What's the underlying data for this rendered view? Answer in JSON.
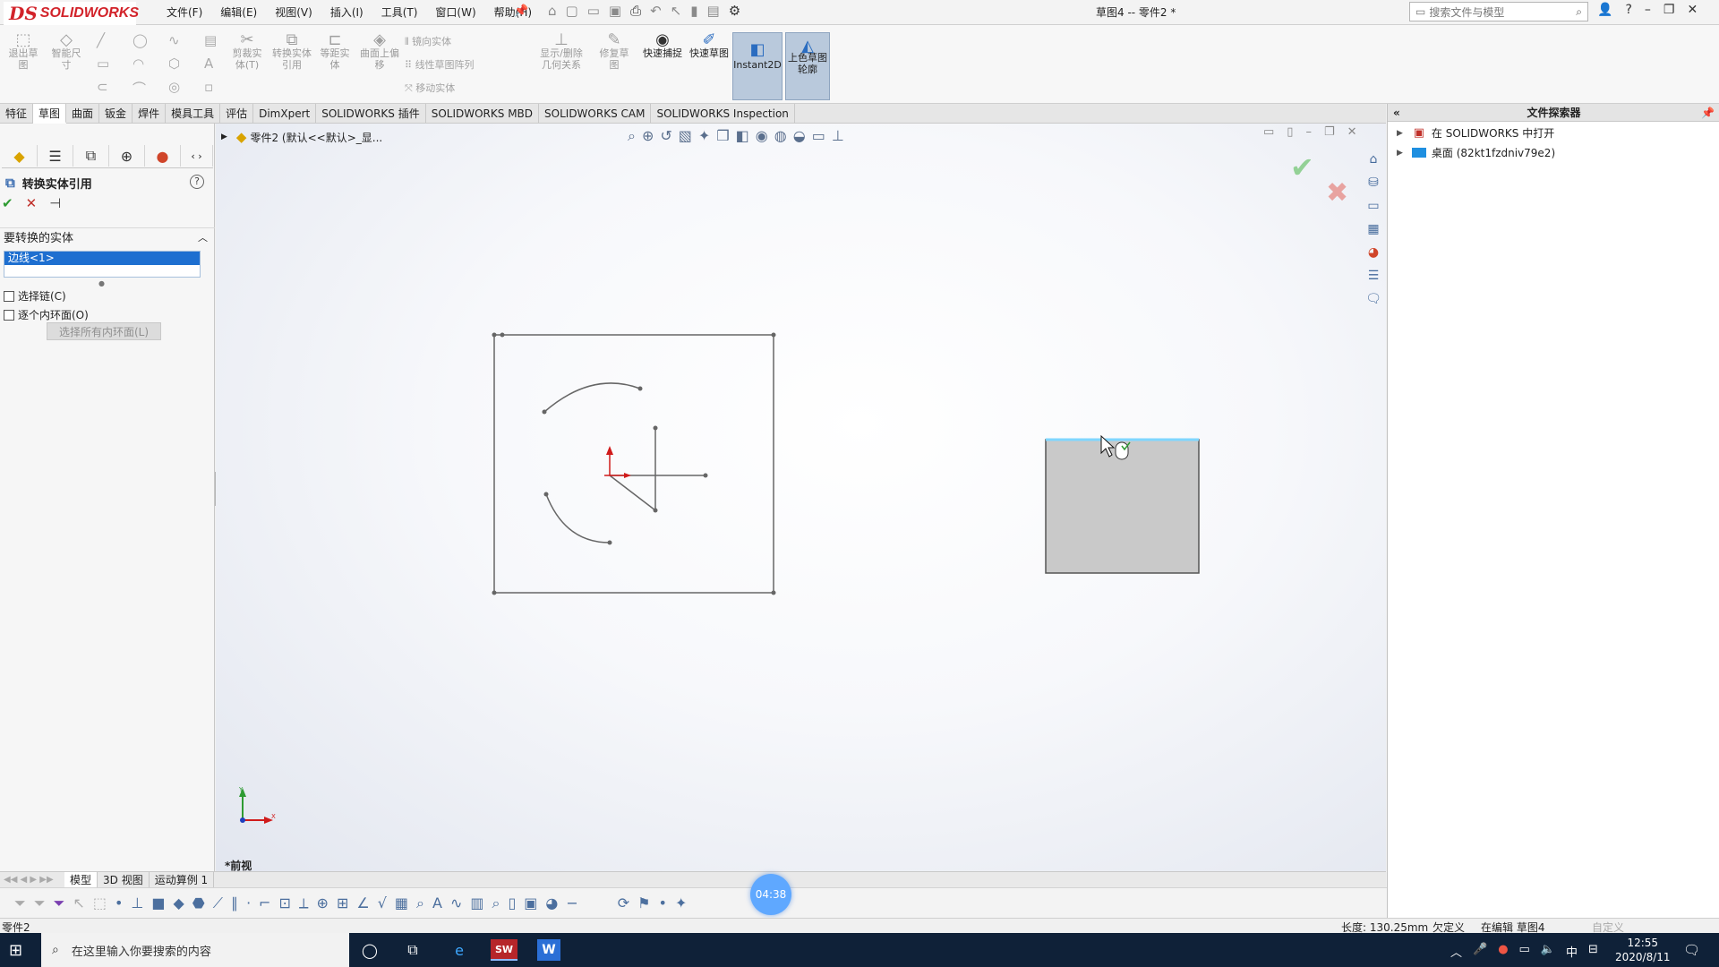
{
  "app": {
    "logo_ds": "DS",
    "logo_name": "SOLIDWORKS",
    "doc_title": "草图4 -- 零件2 *",
    "menus": [
      "文件(F)",
      "编辑(E)",
      "视图(V)",
      "插入(I)",
      "工具(T)",
      "窗口(W)",
      "帮助(H)"
    ],
    "search_placeholder": "搜索文件与模型"
  },
  "ribbon": {
    "exit_sketch": "退出草图",
    "smart_dim": "智能尺寸",
    "trim": "剪裁实体(T)",
    "convert": "转换实体引用",
    "offset": "等距实体",
    "offset_surface": "曲面上偏移",
    "mirror": "镜向实体",
    "linear_pattern": "线性草图阵列",
    "move": "移动实体",
    "display_relations": "显示/删除几何关系",
    "repair": "修复草图",
    "quick_snap": "快速捕捉",
    "rapid_sketch": "快速草图",
    "instant2d": "Instant2D",
    "shaded": "上色草图轮廓"
  },
  "tabs": [
    "特征",
    "草图",
    "曲面",
    "钣金",
    "焊件",
    "模具工具",
    "评估",
    "DimXpert",
    "SOLIDWORKS 插件",
    "SOLIDWORKS MBD",
    "SOLIDWORKS CAM",
    "SOLIDWORKS Inspection"
  ],
  "property_manager": {
    "title": "转换实体引用",
    "section": "要转换的实体",
    "selected_item": "边线<1>",
    "chain_label": "选择链(C)",
    "inner_loop_label": "逐个内环面(O)",
    "select_all_label": "选择所有内环面(L)"
  },
  "viewport": {
    "breadcrumb": "零件2 (默认<<默认>_显...",
    "view_label": "*前视",
    "axis_x": "X",
    "axis_y": "Y"
  },
  "bottom_tabs": [
    "模型",
    "3D 视图",
    "运动算例 1"
  ],
  "timer": "04:38",
  "status": {
    "left": "零件2",
    "length": "长度: 130.25mm",
    "defined": "欠定义",
    "editing": "在编辑 草图4",
    "custom": "自定义"
  },
  "file_explorer": {
    "title": "文件探索器",
    "rows": [
      "在 SOLIDWORKS 中打开",
      "桌面 (82kt1fzdniv79e2)"
    ]
  },
  "taskbar": {
    "search_placeholder": "在这里输入你要搜索的内容",
    "sw_label": "SW",
    "w_label": "W",
    "ime": "中",
    "time": "12:55",
    "date": "2020/8/11"
  },
  "colors": {
    "accent": "#1e6fd0",
    "ok": "#2e9b32",
    "cancel": "#c0302a",
    "sketch_line": "#666666",
    "solid_face": "#c9c9c9",
    "highlight_edge": "#7fd6ff"
  }
}
